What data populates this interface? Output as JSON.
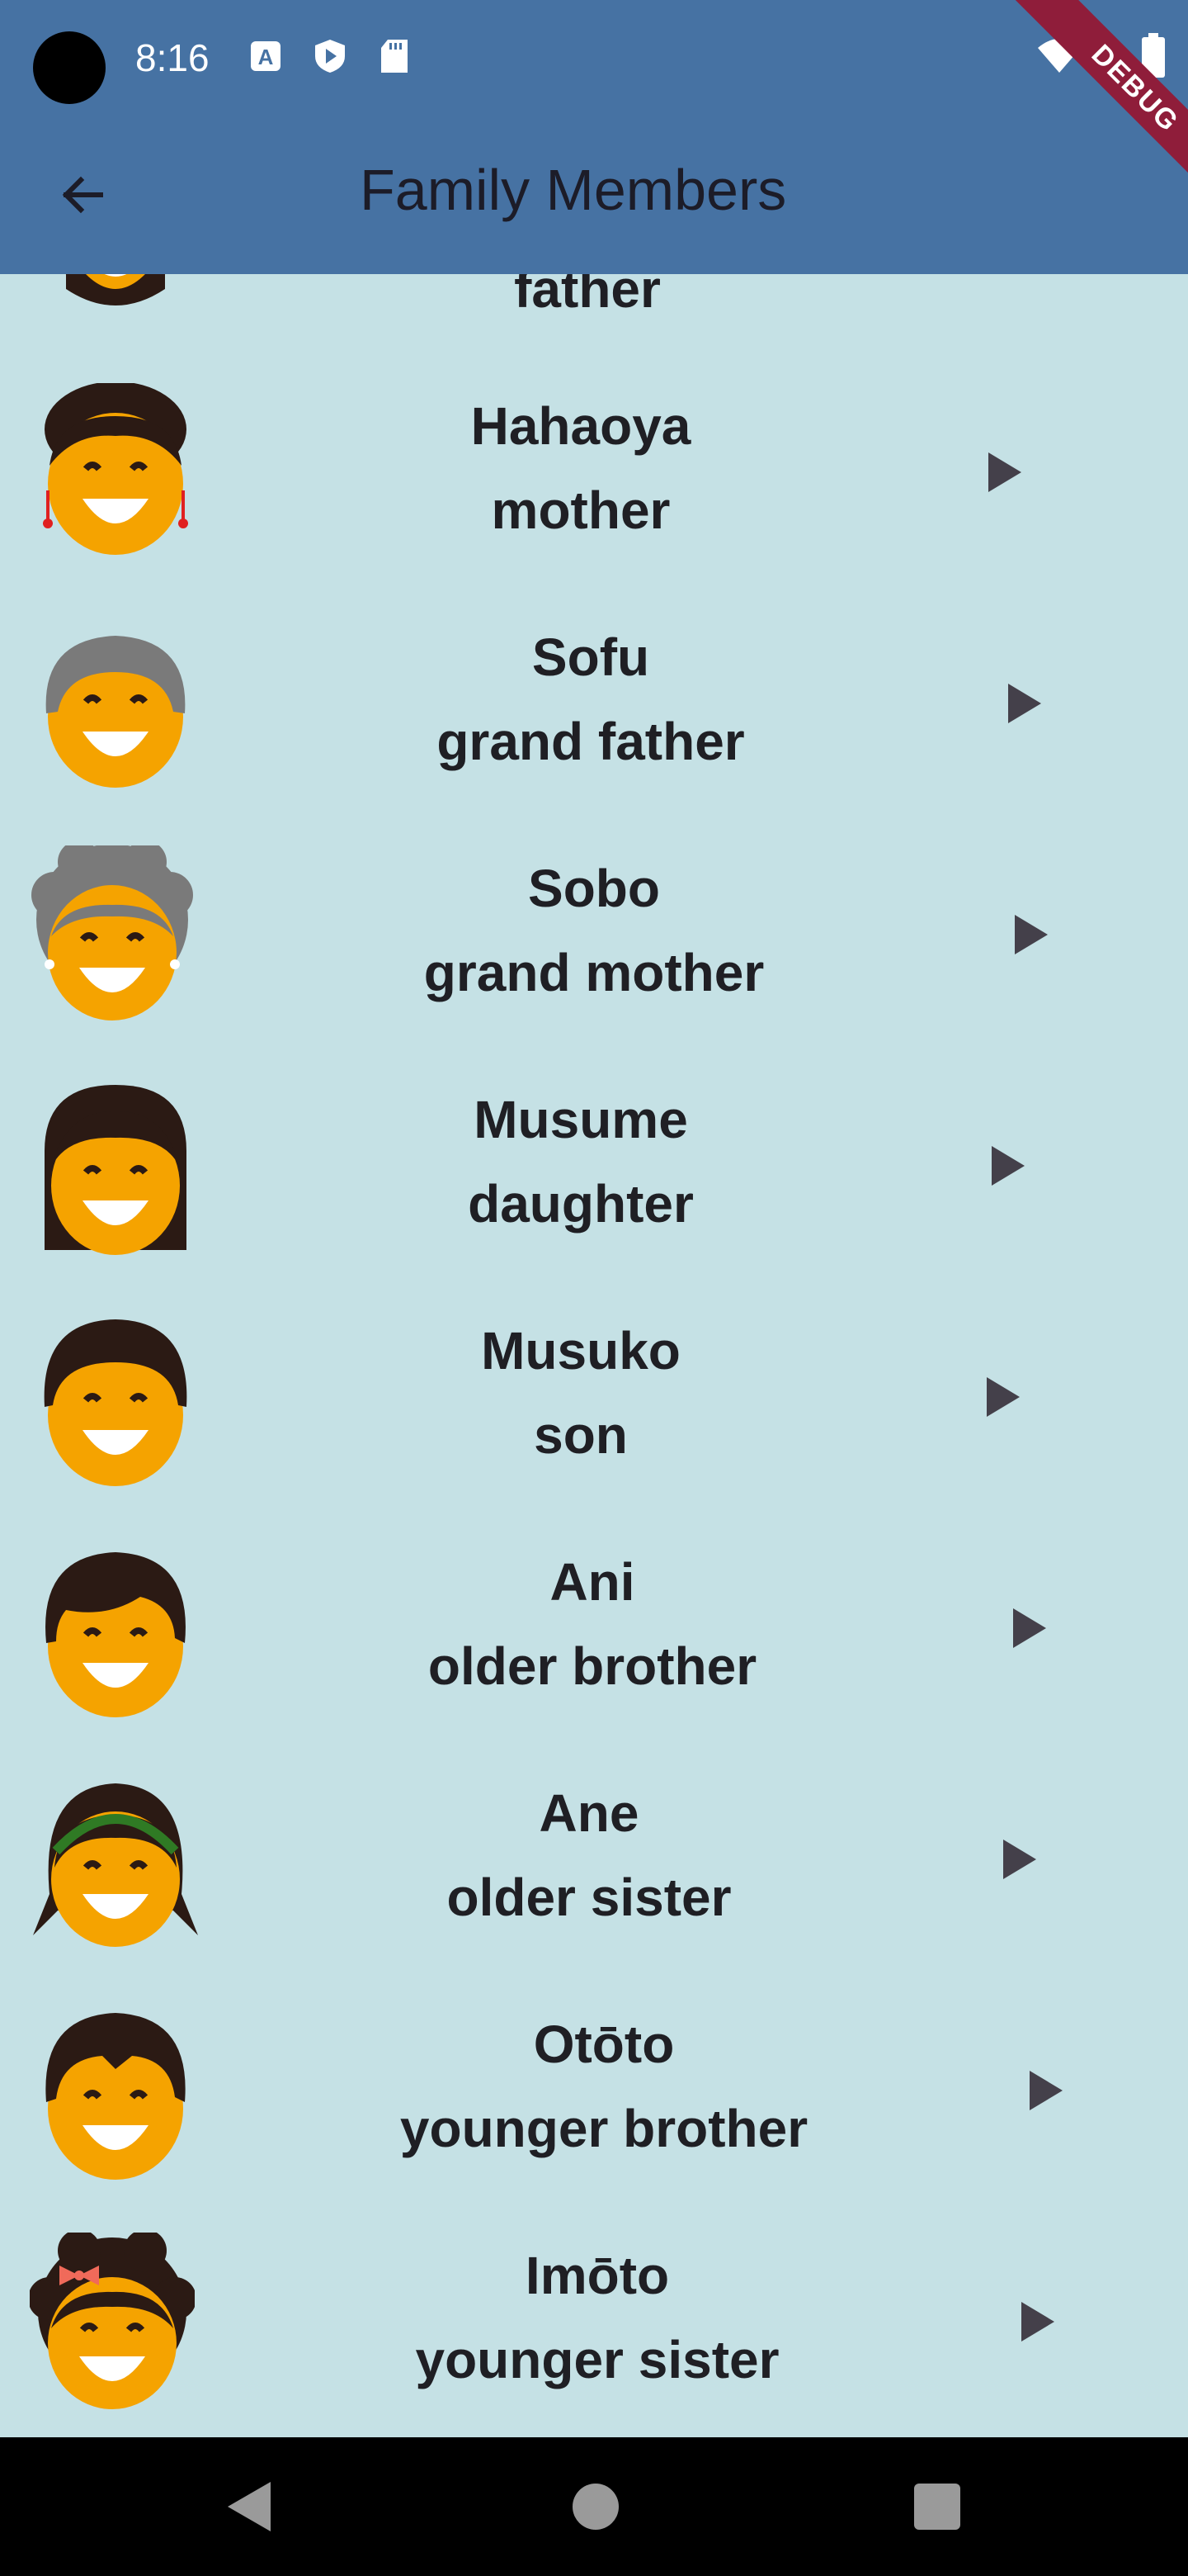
{
  "status_bar": {
    "time": "8:16",
    "icons": [
      "a-text-icon",
      "shield-play-icon",
      "sd-card-icon",
      "wifi-icon",
      "battery-icon"
    ]
  },
  "debug_banner": "DEBUG",
  "app_bar": {
    "title": "Family Members",
    "back_icon": "arrow-left-icon"
  },
  "members": [
    {
      "japanese": "",
      "english": "father",
      "avatar": "father-avatar"
    },
    {
      "japanese": "Hahaoya",
      "english": "mother",
      "avatar": "mother-avatar"
    },
    {
      "japanese": "Sofu",
      "english": "grand father",
      "avatar": "grandfather-avatar"
    },
    {
      "japanese": "Sobo",
      "english": "grand mother",
      "avatar": "grandmother-avatar"
    },
    {
      "japanese": "Musume",
      "english": "daughter",
      "avatar": "daughter-avatar"
    },
    {
      "japanese": "Musuko",
      "english": "son",
      "avatar": "son-avatar"
    },
    {
      "japanese": "Ani",
      "english": "older brother",
      "avatar": "older-brother-avatar"
    },
    {
      "japanese": "Ane",
      "english": "older sister",
      "avatar": "older-sister-avatar"
    },
    {
      "japanese": "Otōto",
      "english": "younger brother",
      "avatar": "younger-brother-avatar"
    },
    {
      "japanese": "Imōto",
      "english": "younger sister",
      "avatar": "younger-sister-avatar"
    }
  ],
  "nav_bar": {
    "icons": [
      "nav-back-icon",
      "nav-home-icon",
      "nav-recents-icon"
    ]
  },
  "colors": {
    "app_bar": "#4672a3",
    "background": "#c5e1e5",
    "face": "#f5a300",
    "hair_dark": "#2b1a14",
    "hair_gray": "#7a7a7a",
    "play": "#44404a"
  }
}
